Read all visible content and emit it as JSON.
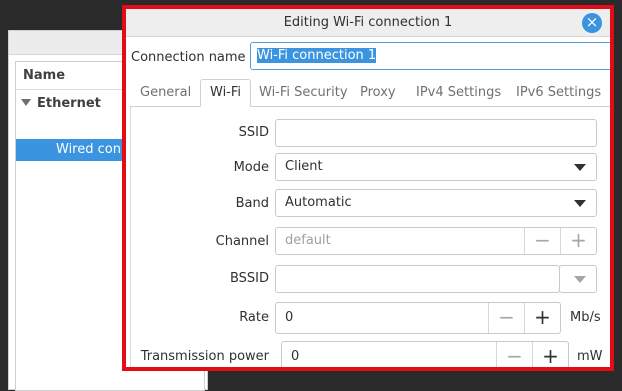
{
  "background_window": {
    "column_header": "Name",
    "group": "Ethernet",
    "item": "Wired conn"
  },
  "dialog": {
    "title": "Editing Wi-Fi connection 1",
    "close_glyph": "×",
    "connection_name_label": "Connection name",
    "connection_name_value": "Wi-Fi connection 1",
    "tabs": [
      "General",
      "Wi-Fi",
      "Wi-Fi Security",
      "Proxy",
      "IPv4 Settings",
      "IPv6 Settings"
    ],
    "active_tab": "Wi-Fi"
  },
  "wifi": {
    "ssid_label": "SSID",
    "ssid_value": "",
    "mode_label": "Mode",
    "mode_value": "Client",
    "band_label": "Band",
    "band_value": "Automatic",
    "channel_label": "Channel",
    "channel_value": "default",
    "bssid_label": "BSSID",
    "bssid_value": "",
    "rate_label": "Rate",
    "rate_value": "0",
    "rate_unit": "Mb/s",
    "tx_power_label": "Transmission power",
    "tx_power_value": "0",
    "tx_power_unit": "mW",
    "minus": "−",
    "plus": "+"
  },
  "colors": {
    "accent": "#3a94e0",
    "highlight_border": "#e10c16"
  }
}
